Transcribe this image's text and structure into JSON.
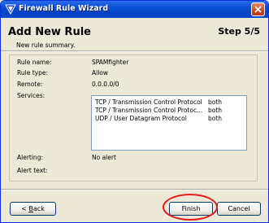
{
  "window": {
    "title": "Firewall Rule Wizard"
  },
  "header": {
    "title": "Add New Rule",
    "step": "Step 5/5",
    "subtitle": "New rule summary."
  },
  "summary": {
    "rule_name_label": "Rule name:",
    "rule_name": "SPAMfighter",
    "rule_type_label": "Rule type:",
    "rule_type": "Allow",
    "remote_label": "Remote:",
    "remote": "0.0.0.0/0",
    "services_label": "Services:",
    "services": [
      {
        "name": "TCP / Transmission Control Protocol",
        "direction": "both"
      },
      {
        "name": "TCP / Transmission Control Protoc...",
        "direction": "both"
      },
      {
        "name": "UDP / User Datagram Protocol",
        "direction": "both"
      }
    ],
    "alerting_label": "Alerting:",
    "alerting": "No alert",
    "alert_text_label": "Alert text:",
    "alert_text": ""
  },
  "buttons": {
    "back_prefix": "< ",
    "back_accel": "B",
    "back_rest": "ack",
    "finish": "Finish",
    "cancel": "Cancel"
  },
  "colors": {
    "titlebar": "#0a4fd6",
    "highlight": "#e51919",
    "dialog_bg": "#ece9d8"
  }
}
